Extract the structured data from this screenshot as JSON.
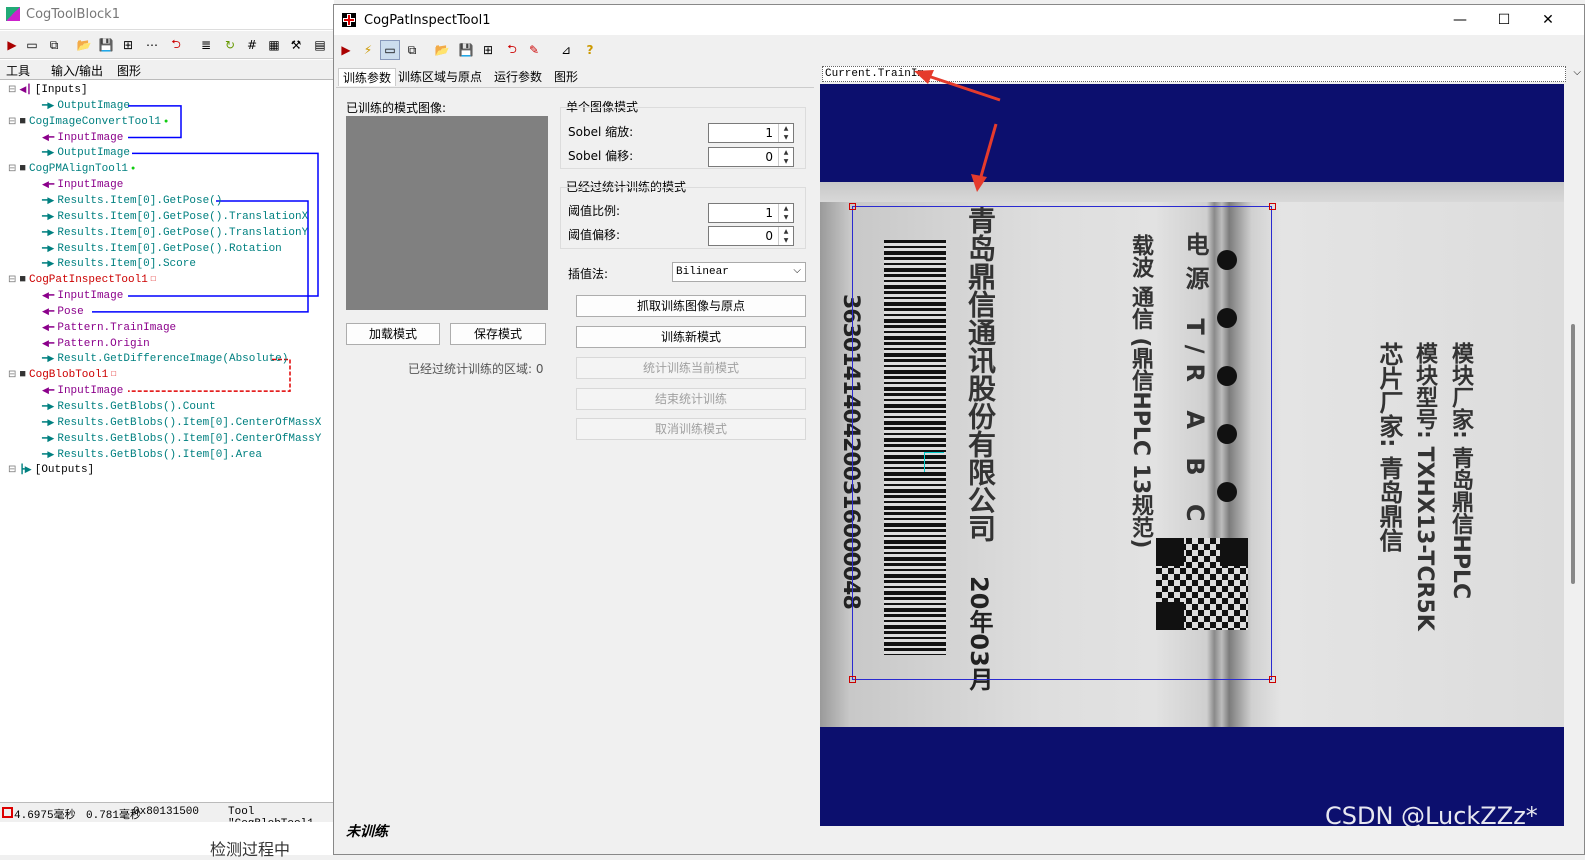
{
  "left_window": {
    "title": "CogToolBlock1",
    "tabs": [
      "工具",
      "输入/输出",
      "图形"
    ],
    "tree": [
      {
        "label": "[Inputs]",
        "color": "dark",
        "indent": 0,
        "icon": "inputs-icon"
      },
      {
        "label": "OutputImage",
        "color": "teal",
        "indent": 1,
        "icon": "output-arrow-icon"
      },
      {
        "label": "CogImageConvertTool1",
        "color": "teal",
        "indent": 0,
        "icon": "image-convert-icon",
        "mark": "green"
      },
      {
        "label": "InputImage",
        "color": "purple",
        "indent": 1,
        "icon": "input-arrow-icon"
      },
      {
        "label": "OutputImage",
        "color": "teal",
        "indent": 1,
        "icon": "output-arrow-icon"
      },
      {
        "label": "CogPMAlignTool1",
        "color": "teal",
        "indent": 0,
        "icon": "pmalign-icon",
        "mark": "green"
      },
      {
        "label": "InputImage",
        "color": "purple",
        "indent": 1,
        "icon": "input-arrow-icon"
      },
      {
        "label": "Results.Item[0].GetPose()",
        "color": "teal",
        "indent": 1,
        "icon": "output-arrow-icon"
      },
      {
        "label": "Results.Item[0].GetPose().TranslationX",
        "color": "teal",
        "indent": 1,
        "icon": "output-arrow-icon"
      },
      {
        "label": "Results.Item[0].GetPose().TranslationY",
        "color": "teal",
        "indent": 1,
        "icon": "output-arrow-icon"
      },
      {
        "label": "Results.Item[0].GetPose().Rotation",
        "color": "teal",
        "indent": 1,
        "icon": "output-arrow-icon"
      },
      {
        "label": "Results.Item[0].Score",
        "color": "teal",
        "indent": 1,
        "icon": "output-arrow-icon"
      },
      {
        "label": "CogPatInspectTool1",
        "color": "red",
        "indent": 0,
        "icon": "patinspect-icon",
        "mark": "red"
      },
      {
        "label": "InputImage",
        "color": "purple",
        "indent": 1,
        "icon": "input-arrow-icon"
      },
      {
        "label": "Pose",
        "color": "purple",
        "indent": 1,
        "icon": "input-arrow-icon"
      },
      {
        "label": "Pattern.TrainImage",
        "color": "purple",
        "indent": 1,
        "icon": "input-arrow-icon"
      },
      {
        "label": "Pattern.Origin",
        "color": "purple",
        "indent": 1,
        "icon": "input-arrow-icon"
      },
      {
        "label": "Result.GetDifferenceImage(Absolute)",
        "color": "teal",
        "indent": 1,
        "icon": "output-arrow-icon"
      },
      {
        "label": "CogBlobTool1",
        "color": "red",
        "indent": 0,
        "icon": "blob-icon",
        "mark": "red"
      },
      {
        "label": "InputImage",
        "color": "purple",
        "indent": 1,
        "icon": "input-arrow-icon"
      },
      {
        "label": "Results.GetBlobs().Count",
        "color": "teal",
        "indent": 1,
        "icon": "output-arrow-icon"
      },
      {
        "label": "Results.GetBlobs().Item[0].CenterOfMassX",
        "color": "teal",
        "indent": 1,
        "icon": "output-arrow-icon"
      },
      {
        "label": "Results.GetBlobs().Item[0].CenterOfMassY",
        "color": "teal",
        "indent": 1,
        "icon": "output-arrow-icon"
      },
      {
        "label": "Results.GetBlobs().Item[0].Area",
        "color": "teal",
        "indent": 1,
        "icon": "output-arrow-icon"
      },
      {
        "label": "[Outputs]",
        "color": "dark",
        "indent": 0,
        "icon": "outputs-icon"
      }
    ],
    "status": {
      "time1": "4.6975毫秒",
      "time2": "0.781毫秒",
      "code": "0x80131500",
      "tool": "Tool \"CogBlobTool1"
    },
    "below_text": "检测过程中"
  },
  "right_window": {
    "title": "CogPatInspectTool1",
    "controls": {
      "minimize": "—",
      "maximize": "☐",
      "close": "✕"
    },
    "tabs": [
      "训练参数",
      "训练区域与原点",
      "运行参数",
      "图形"
    ],
    "trained_label": "已训练的模式图像:",
    "single_group": {
      "title": "单个图像模式",
      "rows": [
        {
          "label": "Sobel 缩放:",
          "value": "1"
        },
        {
          "label": "Sobel 偏移:",
          "value": "0"
        }
      ]
    },
    "stat_group": {
      "title": "已经过统计训练的模式",
      "rows": [
        {
          "label": "阈值比例:",
          "value": "1"
        },
        {
          "label": "阈值偏移:",
          "value": "0"
        }
      ]
    },
    "interp_label": "插值法:",
    "interp_value": "Bilinear",
    "buttons": {
      "load": "加载模式",
      "save": "保存模式",
      "grab": "抓取训练图像与原点",
      "train": "训练新模式",
      "stat_current": "统计训练当前模式",
      "end_stat": "结束统计训练",
      "cancel_train": "取消训练模式"
    },
    "stat_region": "已经过统计训练的区域: 0",
    "status": "未训练",
    "display_select": "Current.TrainIm",
    "image_text": {
      "company": "青岛鼎信通讯股份有限公司",
      "barcode_number": "3630141404200316000048",
      "date": "20年03月",
      "col1": "载波  通信 (鼎信HPLC 13规范)",
      "col2": "电源 T/R A B C",
      "col3": "芯片厂家: 青岛鼎信",
      "col4": "模块型号: TXHX13-TCR5K",
      "col5": "模块厂家: 青岛鼎信HPLC"
    },
    "watermark": "CSDN @LuckZZz*"
  },
  "colors": {
    "accent_teal": "#008080",
    "input_purple": "#8b008b",
    "error_red": "#cc0000",
    "display_bg": "#0c0f6e",
    "link_blue": "#0000ff"
  }
}
